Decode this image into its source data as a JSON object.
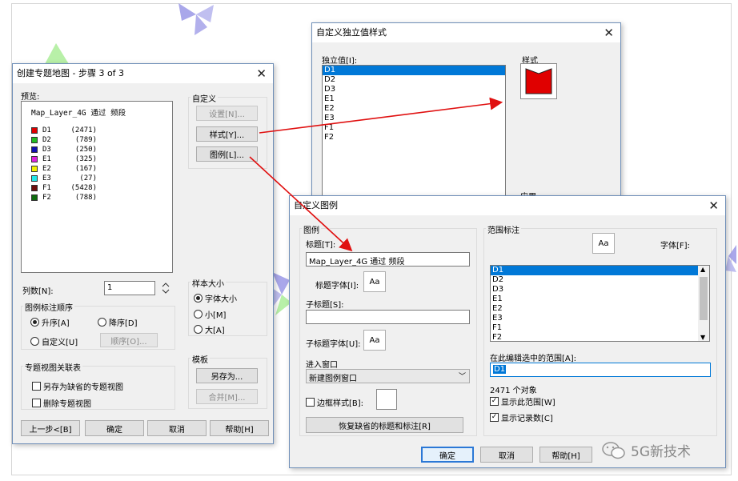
{
  "create_dialog": {
    "title": "创建专题地图 - 步骤 3 of 3",
    "preview_label": "预览:",
    "preview_heading": "Map_Layer_4G 通过 频段",
    "legend": [
      {
        "label": "D1",
        "count": "(2471)",
        "color": "#e00000"
      },
      {
        "label": "D2",
        "count": "(789)",
        "color": "#22bb22"
      },
      {
        "label": "D3",
        "count": "(250)",
        "color": "#1010b0"
      },
      {
        "label": "E1",
        "count": "(325)",
        "color": "#dd22dd"
      },
      {
        "label": "E2",
        "count": "(167)",
        "color": "#f0f000"
      },
      {
        "label": "E3",
        "count": "(27)",
        "color": "#22e8e8"
      },
      {
        "label": "F1",
        "count": "(5428)",
        "color": "#6b0b0b"
      },
      {
        "label": "F2",
        "count": "(788)",
        "color": "#0d6b0d"
      }
    ],
    "custom_group": "自定义",
    "settings_btn": "设置[N]...",
    "style_btn": "样式[Y]...",
    "legend_btn": "图例[L]...",
    "columns_label": "列数[N]:",
    "columns_value": "1",
    "sample_group": "样本大小",
    "sample_options": [
      "字体大小",
      "小[M]",
      "大[A]"
    ],
    "order_group": "图例标注顺序",
    "asc_label": "升序[A]",
    "desc_label": "降序[D]",
    "custom_order_label": "自定义[U]",
    "order_btn": "顺序[O]...",
    "template_group": "模板",
    "save_as_btn": "另存为...",
    "merge_btn": "合并[M]...",
    "assoc_group": "专题视图关联表",
    "save_default_label": "另存为缺省的专题视图",
    "delete_view_label": "删除专题视图",
    "back_btn": "上一步<[B]",
    "ok_btn": "确定",
    "cancel_btn": "取消",
    "help_btn": "帮助[H]"
  },
  "style_dialog": {
    "title": "自定义独立值样式",
    "values_label": "独立值[I]:",
    "values": [
      "D1",
      "D2",
      "D3",
      "E1",
      "E2",
      "E3",
      "F1",
      "F2"
    ],
    "style_label": "样式",
    "swatch_color": "#e00000",
    "apply_label": "应用"
  },
  "legend_dialog": {
    "title": "自定义图例",
    "legend_group": "图例",
    "title_label": "标题[T]:",
    "title_value": "Map_Layer_4G 通过 频段",
    "title_font_label": "标题字体[I]:",
    "font_btn": "Aa",
    "subtitle_label": "子标题[S]:",
    "subtitle_value": "",
    "subtitle_font_label": "子标题字体[U]:",
    "window_label": "进入窗口",
    "window_value": "新建图例窗口",
    "border_label": "边框样式[B]:",
    "restore_btn": "恢复缺省的标题和标注[R]",
    "range_group": "范围标注",
    "range_font_label": "字体[F]:",
    "range_items": [
      "D1",
      "D2",
      "D3",
      "E1",
      "E2",
      "E3",
      "F1",
      "F2"
    ],
    "edit_label": "在此编辑选中的范围[A]:",
    "edit_value": "D1",
    "count_text": "2471 个对象",
    "show_range_label": "显示此范围[W]",
    "show_count_label": "显示记录数[C]",
    "ok_btn": "确定",
    "cancel_btn": "取消",
    "help_btn": "帮助[H]"
  },
  "watermark": "5G新技术",
  "arrow_color": "#e01010"
}
